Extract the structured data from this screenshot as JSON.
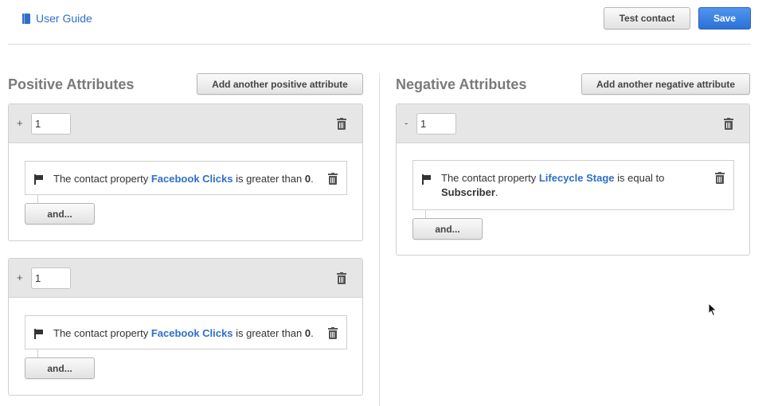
{
  "header": {
    "user_guide_label": "User Guide",
    "test_contact_label": "Test contact",
    "save_label": "Save"
  },
  "positive": {
    "title": "Positive Attributes",
    "add_label": "Add another positive attribute",
    "groups": [
      {
        "sign": "+",
        "value": "1",
        "rule": {
          "prefix": "The contact property",
          "property": "Facebook Clicks",
          "operator": "is greater than",
          "value": "0",
          "suffix": "."
        },
        "and_label": "and..."
      },
      {
        "sign": "+",
        "value": "1",
        "rule": {
          "prefix": "The contact property",
          "property": "Facebook Clicks",
          "operator": "is greater than",
          "value": "0",
          "suffix": "."
        },
        "and_label": "and..."
      }
    ]
  },
  "negative": {
    "title": "Negative Attributes",
    "add_label": "Add another negative attribute",
    "groups": [
      {
        "sign": "-",
        "value": "1",
        "rule": {
          "prefix": "The contact property",
          "property": "Lifecycle Stage",
          "operator": "is equal to",
          "value": "Subscriber",
          "suffix": "."
        },
        "and_label": "and..."
      }
    ]
  },
  "icons": {
    "guide": "book-icon",
    "delete": "trash-icon",
    "rule": "flag-icon",
    "pointer": "mouse-cursor-icon"
  },
  "colors": {
    "link": "#2f6fc9",
    "primary_button": "#3b82e6",
    "section_title": "#7a7a7a",
    "panel_header": "#e6e6e6"
  }
}
